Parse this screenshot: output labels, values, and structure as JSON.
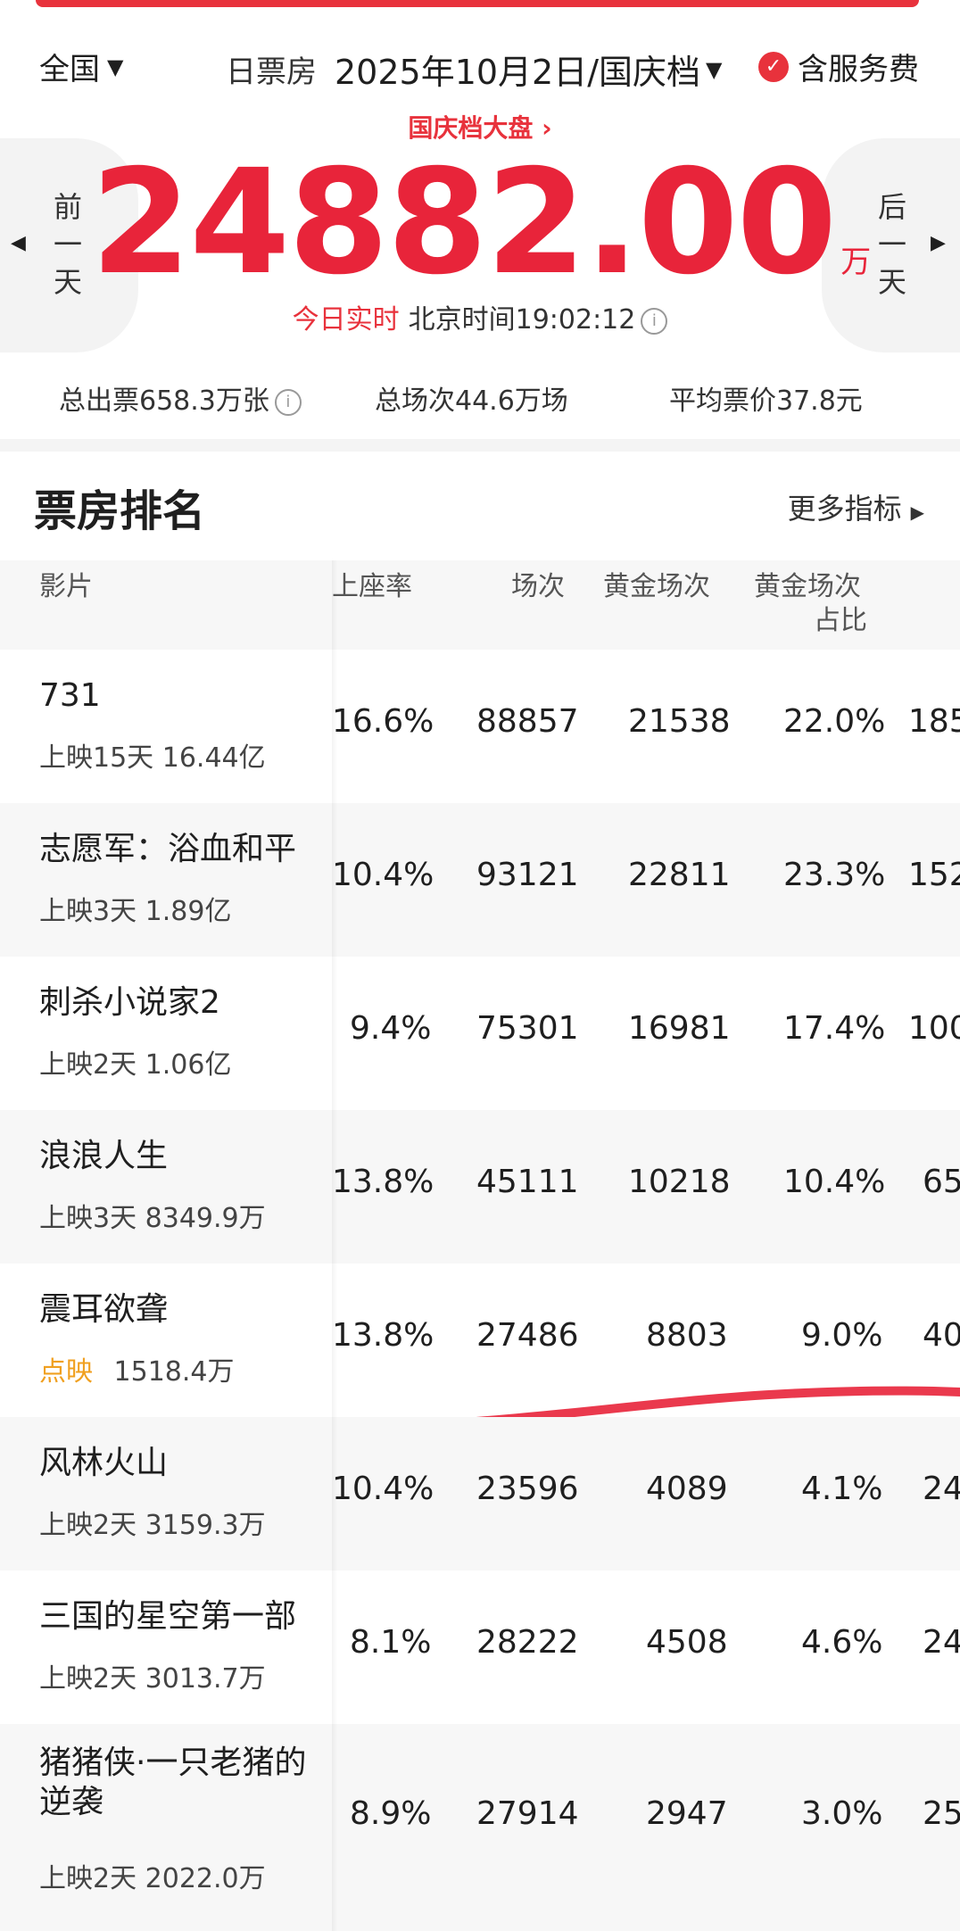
{
  "header": {
    "region": "全国",
    "box_type": "日票房",
    "date": "2025年10月2日/国庆档",
    "service_label": "含服务费",
    "pan_link": "国庆档大盘",
    "prev_day": [
      "前",
      "一",
      "天"
    ],
    "next_day": [
      "后",
      "一",
      "天"
    ],
    "total_value": "24882.00",
    "total_unit": "万",
    "realtime_tag": "今日实时",
    "realtime_time": "北京时间19:02:12",
    "stats": {
      "tickets": "总出票658.3万张",
      "shows": "总场次44.6万场",
      "avg_price": "平均票价37.8元"
    }
  },
  "ranking": {
    "title": "票房排名",
    "more_label": "更多指标",
    "columns": [
      "影片",
      "上座率",
      "场次",
      "黄金场次",
      "黄金场次",
      "占比"
    ],
    "rows": [
      {
        "name": "731",
        "days": "上映15天",
        "total": "16.44亿",
        "occupancy": "16.6%",
        "shows": "88857",
        "golden": "21538",
        "golden_ratio": "22.0%",
        "extra": "185"
      },
      {
        "name": "志愿军：浴血和平",
        "days": "上映3天",
        "total": "1.89亿",
        "occupancy": "10.4%",
        "shows": "93121",
        "golden": "22811",
        "golden_ratio": "23.3%",
        "extra": "152"
      },
      {
        "name": "刺杀小说家2",
        "days": "上映2天",
        "total": "1.06亿",
        "occupancy": "9.4%",
        "shows": "75301",
        "golden": "16981",
        "golden_ratio": "17.4%",
        "extra": "100"
      },
      {
        "name": "浪浪人生",
        "days": "上映3天",
        "total": "8349.9万",
        "occupancy": "13.8%",
        "shows": "45111",
        "golden": "10218",
        "golden_ratio": "10.4%",
        "extra": "65"
      },
      {
        "name": "震耳欲聋",
        "days": "点映",
        "total": "1518.4万",
        "occupancy": "13.8%",
        "shows": "27486",
        "golden": "8803",
        "golden_ratio": "9.0%",
        "extra": "40"
      },
      {
        "name": "风林火山",
        "days": "上映2天",
        "total": "3159.3万",
        "occupancy": "10.4%",
        "shows": "23596",
        "golden": "4089",
        "golden_ratio": "4.1%",
        "extra": "24"
      },
      {
        "name": "三国的星空第一部",
        "days": "上映2天",
        "total": "3013.7万",
        "occupancy": "8.1%",
        "shows": "28222",
        "golden": "4508",
        "golden_ratio": "4.6%",
        "extra": "24"
      },
      {
        "name": "猪猪侠·一只老猪的逆袭",
        "days": "上映2天",
        "total": "2022.0万",
        "occupancy": "8.9%",
        "shows": "27914",
        "golden": "2947",
        "golden_ratio": "3.0%",
        "extra": "25"
      }
    ]
  },
  "colors": {
    "accent": "#e8323c",
    "presale_tag": "#f0a020"
  }
}
